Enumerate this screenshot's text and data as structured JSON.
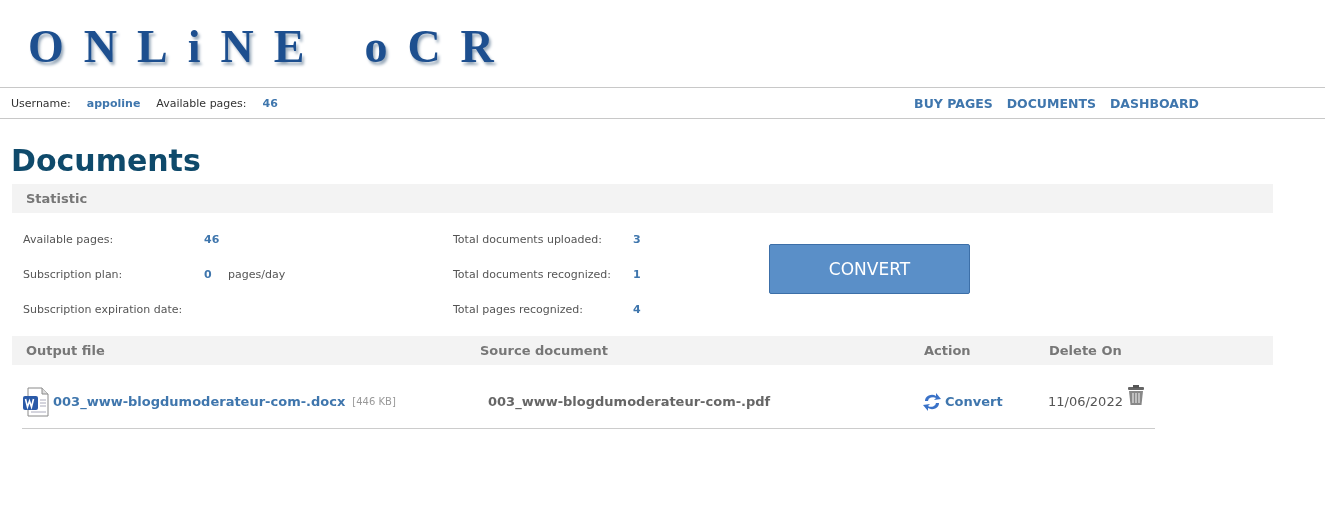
{
  "logo": {
    "words": [
      "ONLiNE",
      "oCR"
    ]
  },
  "user_bar": {
    "username_label": "Username:",
    "username": "appoline",
    "pages_label": "Available pages:",
    "pages": "46"
  },
  "nav": [
    {
      "label": "BUY PAGES"
    },
    {
      "label": "DOCUMENTS"
    },
    {
      "label": "DASHBOARD"
    }
  ],
  "title": "Documents",
  "statistic": {
    "heading": "Statistic",
    "left": [
      {
        "label": "Available pages:",
        "value": "46"
      },
      {
        "label": "Subscription plan:",
        "value": "0",
        "unit": "pages/day"
      },
      {
        "label": "Subscription expiration date:"
      }
    ],
    "right": [
      {
        "label": "Total documents uploaded:",
        "value": "3"
      },
      {
        "label": "Total documents recognized:",
        "value": "1"
      },
      {
        "label": "Total pages recognized:",
        "value": "4"
      }
    ],
    "button": "CONVERT"
  },
  "table": {
    "columns": [
      "Output file",
      "Source document",
      "Action",
      "Delete On"
    ],
    "rows": [
      {
        "output_file": "003_www-blogdumoderateur-com-.docx",
        "size": "[446 KB]",
        "source": "003_www-blogdumoderateur-com-.pdf",
        "action": "Convert",
        "delete_on": "11/06/2022"
      }
    ]
  }
}
